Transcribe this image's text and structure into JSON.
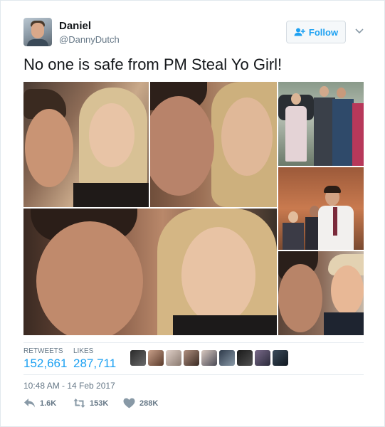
{
  "tweet": {
    "author": {
      "name": "Daniel",
      "handle": "@DannyDutch",
      "avatar": "profile-photo"
    },
    "follow_label": "Follow",
    "text": "No one is safe from PM Steal Yo Girl!",
    "media": {
      "photos": [
        "collage-top-left",
        "collage-top-middle",
        "collage-top-right",
        "collage-right-middle",
        "collage-bottom-large",
        "collage-bottom-right"
      ]
    },
    "stats": {
      "retweets_label": "RETWEETS",
      "retweets_value": "152,661",
      "likes_label": "LIKES",
      "likes_value": "287,711",
      "liker_avatars": 9
    },
    "timestamp": "10:48 AM - 14 Feb 2017",
    "actions": {
      "reply_count": "1.6K",
      "retweet_count": "153K",
      "like_count": "288K"
    }
  },
  "colors": {
    "brand_blue": "#1da1f2",
    "muted_text": "#657786",
    "primary_text": "#14171a",
    "border": "#e1e8ed"
  },
  "icons": {
    "follow": "add-user-icon",
    "menu": "chevron-down-icon",
    "reply": "reply-icon",
    "retweet": "retweet-icon",
    "like": "heart-icon"
  }
}
